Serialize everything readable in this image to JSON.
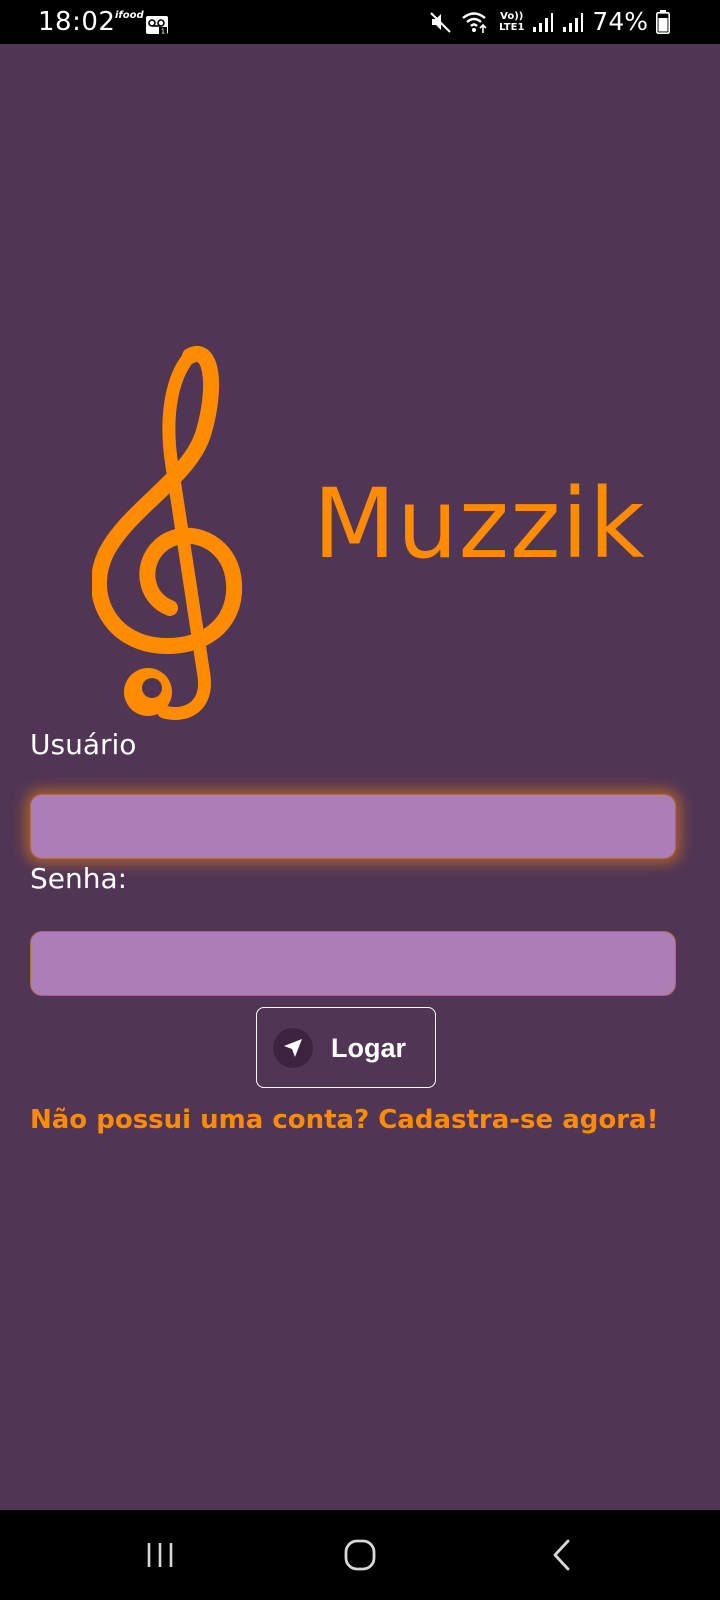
{
  "status_bar": {
    "time": "18:02",
    "ifood_label": "ifood",
    "battery_percent": "74%",
    "network_label_top": "Vo))",
    "network_label_bottom": "LTE1",
    "icons": [
      "voicemail-icon",
      "mute-icon",
      "wifi-icon",
      "signal-icon",
      "battery-icon"
    ]
  },
  "app": {
    "logo_text": "Muzzik",
    "username_label": "Usuário",
    "password_label": "Senha:",
    "username_value": "",
    "password_value": "",
    "login_button_label": "Logar",
    "signup_link": "Não possui uma conta? Cadastra-se agora!"
  },
  "colors": {
    "background": "#513555",
    "accent": "#ff8c00",
    "input_fill": "#ad7db7",
    "text": "#ffffff"
  },
  "nav_bar": {
    "buttons": [
      "recents-icon",
      "home-icon",
      "back-icon"
    ]
  }
}
